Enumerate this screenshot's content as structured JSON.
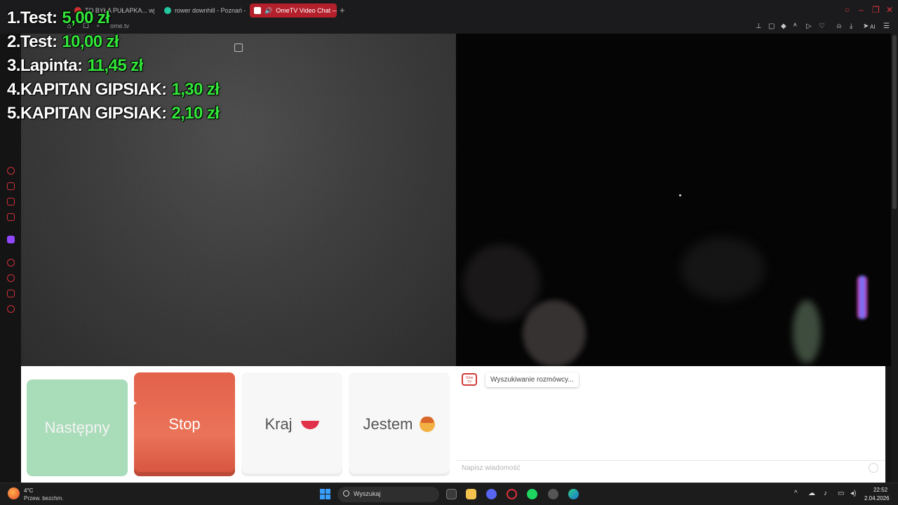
{
  "browser": {
    "tabs": [
      {
        "label": "TO BYŁA PUŁAPKA... wjec",
        "color": "#d03030"
      },
      {
        "label": "rower downhill - Poznań -",
        "color": "#24c8a0"
      },
      {
        "label": "OmeTV Video Chat —",
        "color": "#ffffff",
        "active": true
      }
    ],
    "new_tab": "+",
    "url": "ome.tv",
    "ai_label": "AI"
  },
  "donations": [
    {
      "rank": "1.",
      "name": "Test:",
      "amount": "5,00 zł"
    },
    {
      "rank": "2.",
      "name": "Test:",
      "amount": "10,00 zł"
    },
    {
      "rank": "3.",
      "name": "Lapinta:",
      "amount": "11,45 zł"
    },
    {
      "rank": "4.",
      "name": "KAPITAN GIPSIAK:",
      "amount": "1,30 zł"
    },
    {
      "rank": "5.",
      "name": "KAPITAN GIPSIAK:",
      "amount": "2,10 zł"
    }
  ],
  "controls": {
    "next": "Następny",
    "stop": "Stop",
    "country": "Kraj",
    "me": "Jestem"
  },
  "chat": {
    "logo_text": "Ome TV",
    "status_message": "Wyszukiwanie rozmówcy...",
    "input_placeholder": "Napisz wiadomość"
  },
  "taskbar": {
    "weather_temp": "4°C",
    "weather_desc": "Przew. bezchm.",
    "search_label": "Wyszukaj",
    "time": "22:52",
    "date": "2.04.2026"
  },
  "colors": {
    "donation_amount": "#33e63a",
    "stop_button": "#e8664f",
    "next_button": "#a9dcb9",
    "tab_active": "#b3202c"
  }
}
